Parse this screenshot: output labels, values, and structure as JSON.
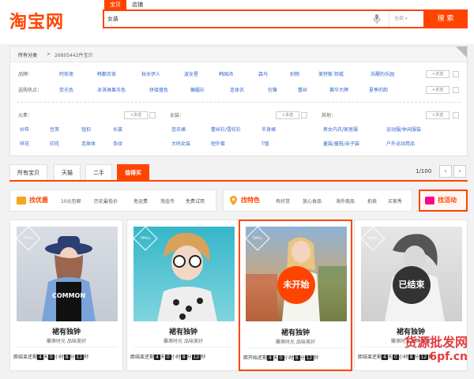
{
  "header": {
    "logo": "淘宝网",
    "search_tabs": [
      "宝贝",
      "店铺"
    ],
    "search_value": "女装",
    "scope": "全部",
    "search_button": "搜 索"
  },
  "filter": {
    "crumb_all": "所有分类",
    "crumb_count": "26805442件宝贝",
    "brand_label": "品牌：",
    "brands": [
      "阿依莲",
      "韩都衣舍",
      "秋水伊人",
      "波女星",
      "韩国鸿",
      "森马",
      "刹物",
      "美特斯·邦威",
      "苏醒的乐园"
    ],
    "hot_label": "选购热点：",
    "hots": [
      "荧光色",
      "冰淇淋果冻色",
      "拼接撞色",
      "蝙蝠衫",
      "连体衣",
      "包臀",
      "蕾丝",
      "赛华大牌",
      "夏季的韵"
    ],
    "more": "+多选",
    "elem_label": "元素：",
    "elems": [
      "纱布",
      "豆荚",
      "钮扣",
      "长裳",
      "碎花",
      "印花",
      "连珠体",
      "条纹"
    ],
    "women_label": "女装：",
    "women": [
      "连衣裙",
      "蕾丝衫/雪纺衫",
      "半身裙",
      "大码女装",
      "短外套",
      "T恤"
    ],
    "other_label": "其他：",
    "others": [
      "男女内衣/家居服",
      "运动服/休闲服装",
      "童装/童鞋/亲子装",
      "户外运动用品"
    ]
  },
  "tabs": [
    "所有宝贝",
    "天猫",
    "二手",
    "值得买"
  ],
  "pager": "1/100",
  "promo_left": {
    "title": "找优惠",
    "links": [
      "10元包邮",
      "历史最低价",
      "免运费",
      "淘金币",
      "免费试用"
    ]
  },
  "promo_mid": {
    "title": "找特色",
    "links": [
      "有好货",
      "放心食品",
      "海外商品",
      "拍卖",
      "买家秀"
    ]
  },
  "promo_right": {
    "title": "找活动"
  },
  "cards": [
    {
      "badge": "TMALL",
      "title": "裙有独钟",
      "sub": "雕琢时光 品味美好",
      "prefix": "距结束还剩",
      "d": "4",
      "h": "0",
      "m": "8",
      "s": "12",
      "stamp": ""
    },
    {
      "badge": "TMALL",
      "title": "裙有独钟",
      "sub": "雕琢时光 品味美好",
      "prefix": "距结束还剩",
      "d": "4",
      "h": "0",
      "m": "8",
      "s": "12",
      "stamp": ""
    },
    {
      "badge": "TMALL",
      "title": "裙有独钟",
      "sub": "雕琢时光 品味美好",
      "prefix": "距开始还剩",
      "d": "4",
      "h": "0",
      "m": "8",
      "s": "12",
      "stamp": "未开始"
    },
    {
      "badge": "TMALL",
      "title": "裙有独钟",
      "sub": "雕琢时光 品味美好",
      "prefix": "距结束还剩",
      "d": "4",
      "h": "0",
      "m": "8",
      "s": "12",
      "stamp": "已结束"
    }
  ],
  "units": {
    "d": "天",
    "h": "小时",
    "m": "分",
    "s": "秒"
  },
  "watermark": {
    "line1": "货源批发网",
    "line2": "6pf.cn"
  },
  "colors": {
    "accent": "#ff4400",
    "link": "#3366cc"
  }
}
